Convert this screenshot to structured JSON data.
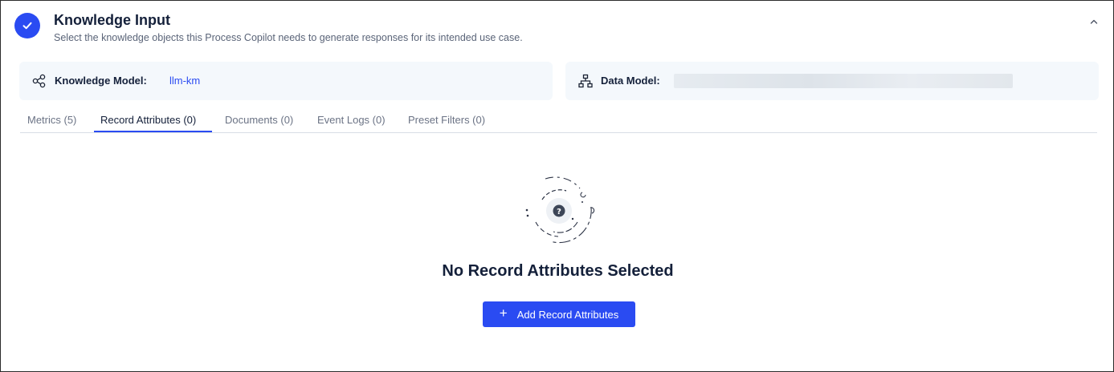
{
  "section": {
    "title": "Knowledge Input",
    "subtitle": "Select the knowledge objects this Process Copilot needs to generate responses for its intended use case.",
    "status_icon": "check-icon",
    "collapse_icon": "chevron-up-icon",
    "accent_color": "#2a4bf2"
  },
  "knowledge_model": {
    "icon": "graph-nodes-icon",
    "label": "Knowledge Model:",
    "value": "llm-km"
  },
  "data_model": {
    "icon": "hierarchy-icon",
    "label": "Data Model:",
    "value_redacted": true
  },
  "tabs": [
    {
      "label": "Metrics (5)",
      "active": false
    },
    {
      "label": "Record Attributes (0)",
      "active": true
    },
    {
      "label": "Documents (0)",
      "active": false
    },
    {
      "label": "Event Logs (0)",
      "active": false
    },
    {
      "label": "Preset Filters (0)",
      "active": false
    }
  ],
  "empty_state": {
    "icon": "question-icon",
    "title": "No Record Attributes Selected",
    "button_label": "Add Record Attributes",
    "button_icon": "plus-icon"
  }
}
